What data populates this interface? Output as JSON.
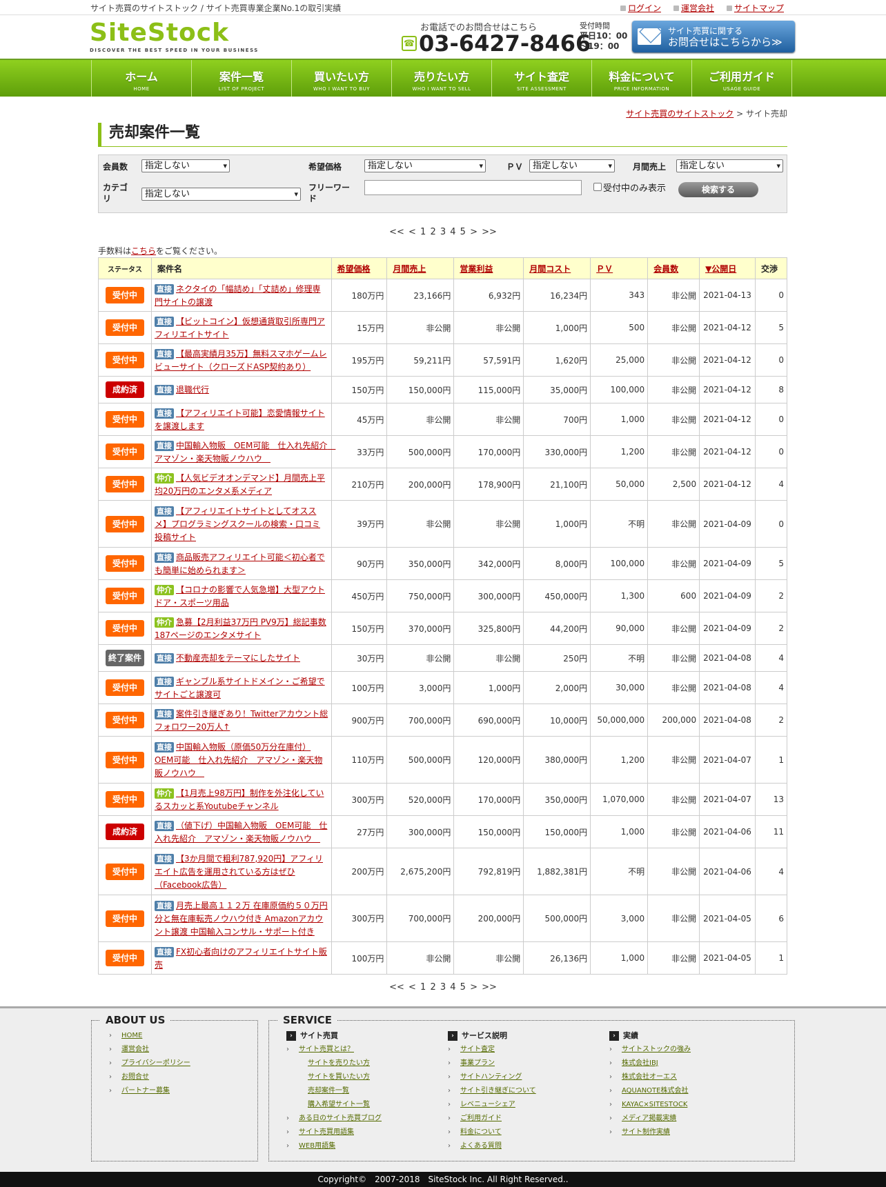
{
  "header": {
    "tagline": "サイト売買のサイトストック / サイト売買専業企業No.1の取引実績",
    "links": [
      "ログイン",
      "運営会社",
      "サイトマップ"
    ],
    "logo_text": "SiteStock",
    "logo_sub": "DISCOVER THE BEST SPEED IN YOUR BUSINESS",
    "tel_lead": "お電話でのお問合せはこちら",
    "tel": "03-6427-8466",
    "hours_label": "受付時間",
    "hours_1": "平日10：00",
    "hours_2": "～19：00",
    "contact_1": "サイト売買に関する",
    "contact_2": "お問合せはこちらから≫"
  },
  "nav": [
    {
      "jp": "ホーム",
      "en": "HOME"
    },
    {
      "jp": "案件一覧",
      "en": "LIST OF PROJECT"
    },
    {
      "jp": "買いたい方",
      "en": "WHO I WANT TO BUY"
    },
    {
      "jp": "売りたい方",
      "en": "WHO I WANT TO SELL"
    },
    {
      "jp": "サイト査定",
      "en": "SITE ASSESSMENT"
    },
    {
      "jp": "料金について",
      "en": "PRICE INFORMATION"
    },
    {
      "jp": "ご利用ガイド",
      "en": "USAGE GUIDE"
    }
  ],
  "breadcrumb": {
    "home": "サイト売買のサイトストック",
    "sep": ">",
    "current": "サイト売却"
  },
  "page_title": "売却案件一覧",
  "filter": {
    "members_label": "会員数",
    "price_label": "希望価格",
    "pv_label": "ＰＶ",
    "sales_label": "月間売上",
    "category_label": "カテゴリ",
    "freeword_label": "フリーワード",
    "unset": "指定しない",
    "accepting_only": "受付中のみ表示",
    "search_button": "検索する"
  },
  "pager": "<< <  1 2 3 4 5 >  >>",
  "fee_note": {
    "pre": "手数料は",
    "link": "こちら",
    "post": "をご覧ください。"
  },
  "table": {
    "headers": [
      "ステータス",
      "案件名",
      "希望価格",
      "月間売上",
      "営業利益",
      "月間コスト",
      "ＰＶ",
      "会員数",
      "▼公開日",
      "交渉"
    ],
    "rows": [
      {
        "status": "受付中",
        "type": "直接",
        "title": "ネクタイの「幅詰め」「丈詰め」修理専門サイトの譲渡",
        "price": "180万円",
        "sales": "23,166円",
        "profit": "6,932円",
        "cost": "16,234円",
        "pv": "343",
        "members": "非公開",
        "date": "2021-04-13",
        "nego": "0"
      },
      {
        "status": "受付中",
        "type": "直接",
        "title": "【ビットコイン】仮想通貨取引所専門アフィリエイトサイト",
        "price": "15万円",
        "sales": "非公開",
        "profit": "非公開",
        "cost": "1,000円",
        "pv": "500",
        "members": "非公開",
        "date": "2021-04-12",
        "nego": "5"
      },
      {
        "status": "受付中",
        "type": "直接",
        "title": "【最高実績月35万】無料スマホゲームレビューサイト（クローズドASP契約あり）",
        "price": "195万円",
        "sales": "59,211円",
        "profit": "57,591円",
        "cost": "1,620円",
        "pv": "25,000",
        "members": "非公開",
        "date": "2021-04-12",
        "nego": "0"
      },
      {
        "status": "成約済",
        "type": "直接",
        "title": "退職代行",
        "price": "150万円",
        "sales": "150,000円",
        "profit": "115,000円",
        "cost": "35,000円",
        "pv": "100,000",
        "members": "非公開",
        "date": "2021-04-12",
        "nego": "8"
      },
      {
        "status": "受付中",
        "type": "直接",
        "title": "【アフィリエイト可能】恋愛情報サイトを譲渡します",
        "price": "45万円",
        "sales": "非公開",
        "profit": "非公開",
        "cost": "700円",
        "pv": "1,000",
        "members": "非公開",
        "date": "2021-04-12",
        "nego": "0"
      },
      {
        "status": "受付中",
        "type": "直接",
        "title": "中国輸入物販　OEM可能　仕入れ先紹介　アマゾン・楽天物販ノウハウ　",
        "price": "33万円",
        "sales": "500,000円",
        "profit": "170,000円",
        "cost": "330,000円",
        "pv": "1,200",
        "members": "非公開",
        "date": "2021-04-12",
        "nego": "0"
      },
      {
        "status": "受付中",
        "type": "仲介",
        "title": "【人気ビデオオンデマンド】月間売上平均20万円のエンタメ系メディア",
        "price": "210万円",
        "sales": "200,000円",
        "profit": "178,900円",
        "cost": "21,100円",
        "pv": "50,000",
        "members": "2,500",
        "date": "2021-04-12",
        "nego": "4"
      },
      {
        "status": "受付中",
        "type": "直接",
        "title": "【アフィリエイトサイトとしてオススメ】プログラミングスクールの検索・口コミ投稿サイト",
        "price": "39万円",
        "sales": "非公開",
        "profit": "非公開",
        "cost": "1,000円",
        "pv": "不明",
        "members": "非公開",
        "date": "2021-04-09",
        "nego": "0"
      },
      {
        "status": "受付中",
        "type": "直接",
        "title": "商品販売アフィリエイト可能＜初心者でも簡単に始められます＞",
        "price": "90万円",
        "sales": "350,000円",
        "profit": "342,000円",
        "cost": "8,000円",
        "pv": "100,000",
        "members": "非公開",
        "date": "2021-04-09",
        "nego": "5"
      },
      {
        "status": "受付中",
        "type": "仲介",
        "title": "【コロナの影響で人気急増】大型アウトドア・スポーツ用品",
        "price": "450万円",
        "sales": "750,000円",
        "profit": "300,000円",
        "cost": "450,000円",
        "pv": "1,300",
        "members": "600",
        "date": "2021-04-09",
        "nego": "2"
      },
      {
        "status": "受付中",
        "type": "仲介",
        "title": "急募【2月利益37万円 PV9万】総記事数187ページのエンタメサイト",
        "price": "150万円",
        "sales": "370,000円",
        "profit": "325,800円",
        "cost": "44,200円",
        "pv": "90,000",
        "members": "非公開",
        "date": "2021-04-09",
        "nego": "2"
      },
      {
        "status": "終了案件",
        "type": "直接",
        "title": "不動産売却をテーマにしたサイト",
        "price": "30万円",
        "sales": "非公開",
        "profit": "非公開",
        "cost": "250円",
        "pv": "不明",
        "members": "非公開",
        "date": "2021-04-08",
        "nego": "4"
      },
      {
        "status": "受付中",
        "type": "直接",
        "title": "ギャンブル系サイトドメイン・ご希望でサイトごと譲渡可",
        "price": "100万円",
        "sales": "3,000円",
        "profit": "1,000円",
        "cost": "2,000円",
        "pv": "30,000",
        "members": "非公開",
        "date": "2021-04-08",
        "nego": "4"
      },
      {
        "status": "受付中",
        "type": "直接",
        "title": "案件引き継ぎあり！Twitterアカウント総フォロワー20万人↑",
        "price": "900万円",
        "sales": "700,000円",
        "profit": "690,000円",
        "cost": "10,000円",
        "pv": "50,000,000",
        "members": "200,000",
        "date": "2021-04-08",
        "nego": "2"
      },
      {
        "status": "受付中",
        "type": "直接",
        "title": "中国輸入物販（原価50万分在庫付）OEM可能　仕入れ先紹介　アマゾン・楽天物販ノウハウ　",
        "price": "110万円",
        "sales": "500,000円",
        "profit": "120,000円",
        "cost": "380,000円",
        "pv": "1,200",
        "members": "非公開",
        "date": "2021-04-07",
        "nego": "1"
      },
      {
        "status": "受付中",
        "type": "仲介",
        "title": "【1月売上98万円】制作を外注化しているスカッと系Youtubeチャンネル",
        "price": "300万円",
        "sales": "520,000円",
        "profit": "170,000円",
        "cost": "350,000円",
        "pv": "1,070,000",
        "members": "非公開",
        "date": "2021-04-07",
        "nego": "13"
      },
      {
        "status": "成約済",
        "type": "直接",
        "title": "（値下げ）中国輸入物販　OEM可能　仕入れ先紹介　アマゾン・楽天物販ノウハウ　",
        "price": "27万円",
        "sales": "300,000円",
        "profit": "150,000円",
        "cost": "150,000円",
        "pv": "1,000",
        "members": "非公開",
        "date": "2021-04-06",
        "nego": "11"
      },
      {
        "status": "受付中",
        "type": "直接",
        "title": "【3か月間で粗利787,920円】アフィリエイト広告を運用されている方はぜひ（Facebook広告）",
        "price": "200万円",
        "sales": "2,675,200円",
        "profit": "792,819円",
        "cost": "1,882,381円",
        "pv": "不明",
        "members": "非公開",
        "date": "2021-04-06",
        "nego": "4"
      },
      {
        "status": "受付中",
        "type": "直接",
        "title": "月売上最高１１２万 在庫原価約５０万円分と無在庫転売ノウハウ付き Amazonアカウント譲渡 中国輸入コンサル・サポート付き",
        "price": "300万円",
        "sales": "700,000円",
        "profit": "200,000円",
        "cost": "500,000円",
        "pv": "3,000",
        "members": "非公開",
        "date": "2021-04-05",
        "nego": "6"
      },
      {
        "status": "受付中",
        "type": "直接",
        "title": "FX初心者向けのアフィリエイトサイト販売",
        "price": "100万円",
        "sales": "非公開",
        "profit": "非公開",
        "cost": "26,136円",
        "pv": "1,000",
        "members": "非公開",
        "date": "2021-04-05",
        "nego": "1"
      }
    ]
  },
  "footer": {
    "about_title": "ABOUT US",
    "about_links": [
      "HOME",
      "運営会社",
      "プライバシーポリシー",
      "お問合せ",
      "パートナー募集"
    ],
    "service_title": "SERVICE",
    "col1_head": "サイト売買",
    "col1": [
      {
        "t": "サイト売買とは？",
        "ind": false
      },
      {
        "t": "サイトを売りたい方",
        "ind": true
      },
      {
        "t": "サイトを買いたい方",
        "ind": true
      },
      {
        "t": "売却案件一覧",
        "ind": true
      },
      {
        "t": "購入希望サイト一覧",
        "ind": true
      },
      {
        "t": "ある日のサイト売買ブログ",
        "ind": false
      },
      {
        "t": "サイト売買用語集",
        "ind": false
      },
      {
        "t": "WEB用語集",
        "ind": false
      }
    ],
    "col2_head": "サービス説明",
    "col2": [
      "サイト査定",
      "事業プラン",
      "サイトハンティング",
      "サイト引き継ぎについて",
      "レベニューシェア",
      "ご利用ガイド",
      "料金について",
      "よくある質問"
    ],
    "col3_head": "実績",
    "col3": [
      "サイトストックの強み",
      "株式会社IBJ",
      "株式会社オーエス",
      "AQUANOTE株式会社",
      "KAYAC×SITESTOCK",
      "メディア掲載実績",
      "サイト制作実績"
    ],
    "copyright": "Copyright©　2007-2018　SiteStock Inc. All Right Reserved.."
  }
}
